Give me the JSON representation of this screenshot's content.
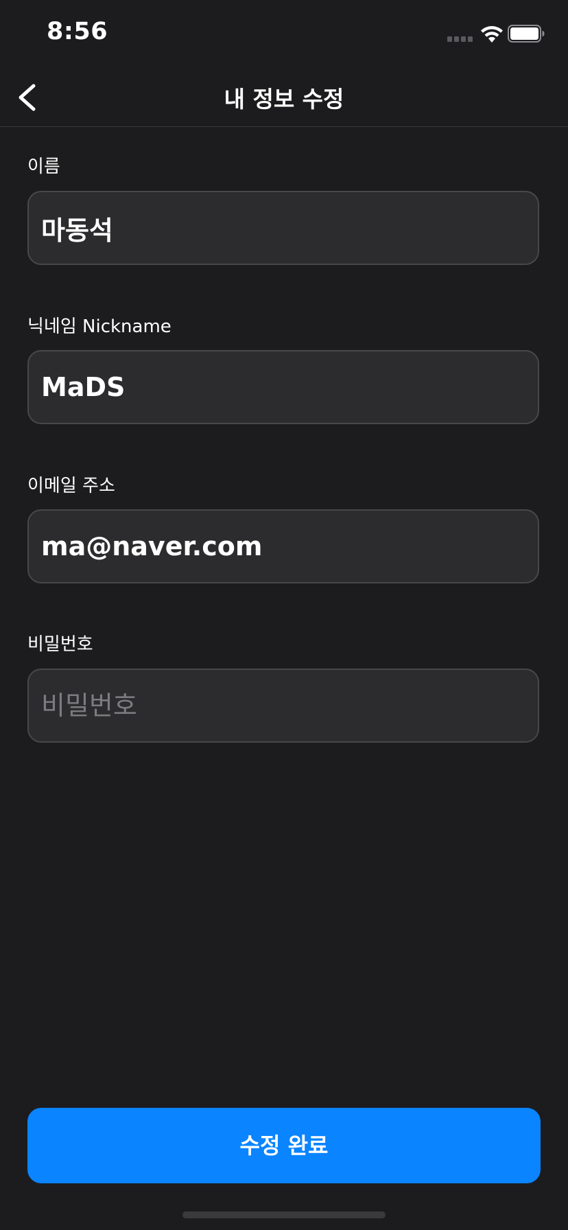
{
  "status_bar": {
    "time": "8:56",
    "signal_icon": "cellular-signal-icon",
    "wifi_icon": "wifi-icon",
    "battery_icon": "battery-icon"
  },
  "nav": {
    "title": "내 정보 수정",
    "back_icon": "chevron-left-icon"
  },
  "form": {
    "name": {
      "label": "이름",
      "value": "마동석",
      "placeholder": ""
    },
    "nickname": {
      "label": "닉네임 Nickname",
      "value": "MaDS",
      "placeholder": ""
    },
    "email": {
      "label": "이메일 주소",
      "value": "ma@naver.com",
      "placeholder": ""
    },
    "password": {
      "label": "비밀번호",
      "value": "",
      "placeholder": "비밀번호"
    }
  },
  "submit_label": "수정 완료",
  "colors": {
    "background": "#1c1c1e",
    "field_background": "#2c2c2e",
    "field_border": "#48484a",
    "accent": "#0a84ff",
    "placeholder": "#7c7c80"
  }
}
